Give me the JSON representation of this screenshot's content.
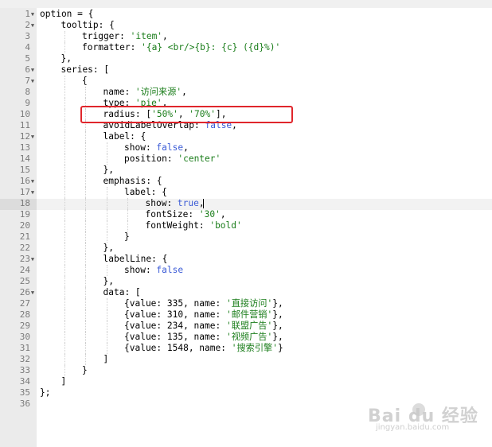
{
  "top_bar": {
    "title": ""
  },
  "editor": {
    "active_line": 18,
    "lines": [
      {
        "n": "1",
        "fold": true,
        "indent": 0,
        "tokens": [
          [
            "p",
            "option = {"
          ]
        ]
      },
      {
        "n": "2",
        "fold": true,
        "indent": 1,
        "tokens": [
          [
            "p",
            "tooltip: {"
          ]
        ]
      },
      {
        "n": "3",
        "fold": false,
        "indent": 2,
        "tokens": [
          [
            "p",
            "trigger: "
          ],
          [
            "s",
            "'item'"
          ],
          [
            "p",
            ","
          ]
        ]
      },
      {
        "n": "4",
        "fold": false,
        "indent": 2,
        "tokens": [
          [
            "p",
            "formatter: "
          ],
          [
            "s",
            "'{a} <br/>{b}: {c} ({d}%)'"
          ]
        ]
      },
      {
        "n": "5",
        "fold": false,
        "indent": 1,
        "tokens": [
          [
            "p",
            "},"
          ]
        ]
      },
      {
        "n": "6",
        "fold": true,
        "indent": 1,
        "tokens": [
          [
            "p",
            "series: ["
          ]
        ]
      },
      {
        "n": "7",
        "fold": true,
        "indent": 2,
        "tokens": [
          [
            "p",
            "{"
          ]
        ]
      },
      {
        "n": "8",
        "fold": false,
        "indent": 3,
        "tokens": [
          [
            "p",
            "name: "
          ],
          [
            "s",
            "'访问来源'"
          ],
          [
            "p",
            ","
          ]
        ]
      },
      {
        "n": "9",
        "fold": false,
        "indent": 3,
        "tokens": [
          [
            "p",
            "type: "
          ],
          [
            "s",
            "'pie'"
          ],
          [
            "p",
            ","
          ]
        ]
      },
      {
        "n": "10",
        "fold": false,
        "indent": 3,
        "tokens": [
          [
            "p",
            "radius: ["
          ],
          [
            "s",
            "'50%'"
          ],
          [
            "p",
            ", "
          ],
          [
            "s",
            "'70%'"
          ],
          [
            "p",
            "],"
          ]
        ]
      },
      {
        "n": "11",
        "fold": false,
        "indent": 3,
        "tokens": [
          [
            "p",
            "avoidLabelOverlap: "
          ],
          [
            "k",
            "false"
          ],
          [
            "p",
            ","
          ]
        ]
      },
      {
        "n": "12",
        "fold": true,
        "indent": 3,
        "tokens": [
          [
            "p",
            "label: {"
          ]
        ]
      },
      {
        "n": "13",
        "fold": false,
        "indent": 4,
        "tokens": [
          [
            "p",
            "show: "
          ],
          [
            "k",
            "false"
          ],
          [
            "p",
            ","
          ]
        ]
      },
      {
        "n": "14",
        "fold": false,
        "indent": 4,
        "tokens": [
          [
            "p",
            "position: "
          ],
          [
            "s",
            "'center'"
          ]
        ]
      },
      {
        "n": "15",
        "fold": false,
        "indent": 3,
        "tokens": [
          [
            "p",
            "},"
          ]
        ]
      },
      {
        "n": "16",
        "fold": true,
        "indent": 3,
        "tokens": [
          [
            "p",
            "emphasis: {"
          ]
        ]
      },
      {
        "n": "17",
        "fold": true,
        "indent": 4,
        "tokens": [
          [
            "p",
            "label: {"
          ]
        ]
      },
      {
        "n": "18",
        "fold": false,
        "indent": 5,
        "tokens": [
          [
            "p",
            "show: "
          ],
          [
            "k",
            "true"
          ],
          [
            "p",
            ","
          ]
        ]
      },
      {
        "n": "19",
        "fold": false,
        "indent": 5,
        "tokens": [
          [
            "p",
            "fontSize: "
          ],
          [
            "s",
            "'30'"
          ],
          [
            "p",
            ","
          ]
        ]
      },
      {
        "n": "20",
        "fold": false,
        "indent": 5,
        "tokens": [
          [
            "p",
            "fontWeight: "
          ],
          [
            "s",
            "'bold'"
          ]
        ]
      },
      {
        "n": "21",
        "fold": false,
        "indent": 4,
        "tokens": [
          [
            "p",
            "}"
          ]
        ]
      },
      {
        "n": "22",
        "fold": false,
        "indent": 3,
        "tokens": [
          [
            "p",
            "},"
          ]
        ]
      },
      {
        "n": "23",
        "fold": true,
        "indent": 3,
        "tokens": [
          [
            "p",
            "labelLine: {"
          ]
        ]
      },
      {
        "n": "24",
        "fold": false,
        "indent": 4,
        "tokens": [
          [
            "p",
            "show: "
          ],
          [
            "k",
            "false"
          ]
        ]
      },
      {
        "n": "25",
        "fold": false,
        "indent": 3,
        "tokens": [
          [
            "p",
            "},"
          ]
        ]
      },
      {
        "n": "26",
        "fold": true,
        "indent": 3,
        "tokens": [
          [
            "p",
            "data: ["
          ]
        ]
      },
      {
        "n": "27",
        "fold": false,
        "indent": 4,
        "tokens": [
          [
            "p",
            "{value: 335, name: "
          ],
          [
            "s",
            "'直接访问'"
          ],
          [
            "p",
            "},"
          ]
        ]
      },
      {
        "n": "28",
        "fold": false,
        "indent": 4,
        "tokens": [
          [
            "p",
            "{value: 310, name: "
          ],
          [
            "s",
            "'邮件营销'"
          ],
          [
            "p",
            "},"
          ]
        ]
      },
      {
        "n": "29",
        "fold": false,
        "indent": 4,
        "tokens": [
          [
            "p",
            "{value: 234, name: "
          ],
          [
            "s",
            "'联盟广告'"
          ],
          [
            "p",
            "},"
          ]
        ]
      },
      {
        "n": "30",
        "fold": false,
        "indent": 4,
        "tokens": [
          [
            "p",
            "{value: 135, name: "
          ],
          [
            "s",
            "'视频广告'"
          ],
          [
            "p",
            "},"
          ]
        ]
      },
      {
        "n": "31",
        "fold": false,
        "indent": 4,
        "tokens": [
          [
            "p",
            "{value: 1548, name: "
          ],
          [
            "s",
            "'搜索引擎'"
          ],
          [
            "p",
            "}"
          ]
        ]
      },
      {
        "n": "32",
        "fold": false,
        "indent": 3,
        "tokens": [
          [
            "p",
            "]"
          ]
        ]
      },
      {
        "n": "33",
        "fold": false,
        "indent": 2,
        "tokens": [
          [
            "p",
            "}"
          ]
        ]
      },
      {
        "n": "34",
        "fold": false,
        "indent": 1,
        "tokens": [
          [
            "p",
            "]"
          ]
        ]
      },
      {
        "n": "35",
        "fold": false,
        "indent": 0,
        "tokens": [
          [
            "p",
            "};"
          ]
        ]
      },
      {
        "n": "36",
        "fold": false,
        "indent": 0,
        "tokens": []
      }
    ]
  },
  "watermark": {
    "brand": "Bai du 经验",
    "url": "jingyan.baidu.com"
  },
  "colors": {
    "string": "#1a7d1a",
    "keyword": "#3b5bd6",
    "highlight_box": "#e0262c",
    "gutter": "#ebebeb"
  }
}
